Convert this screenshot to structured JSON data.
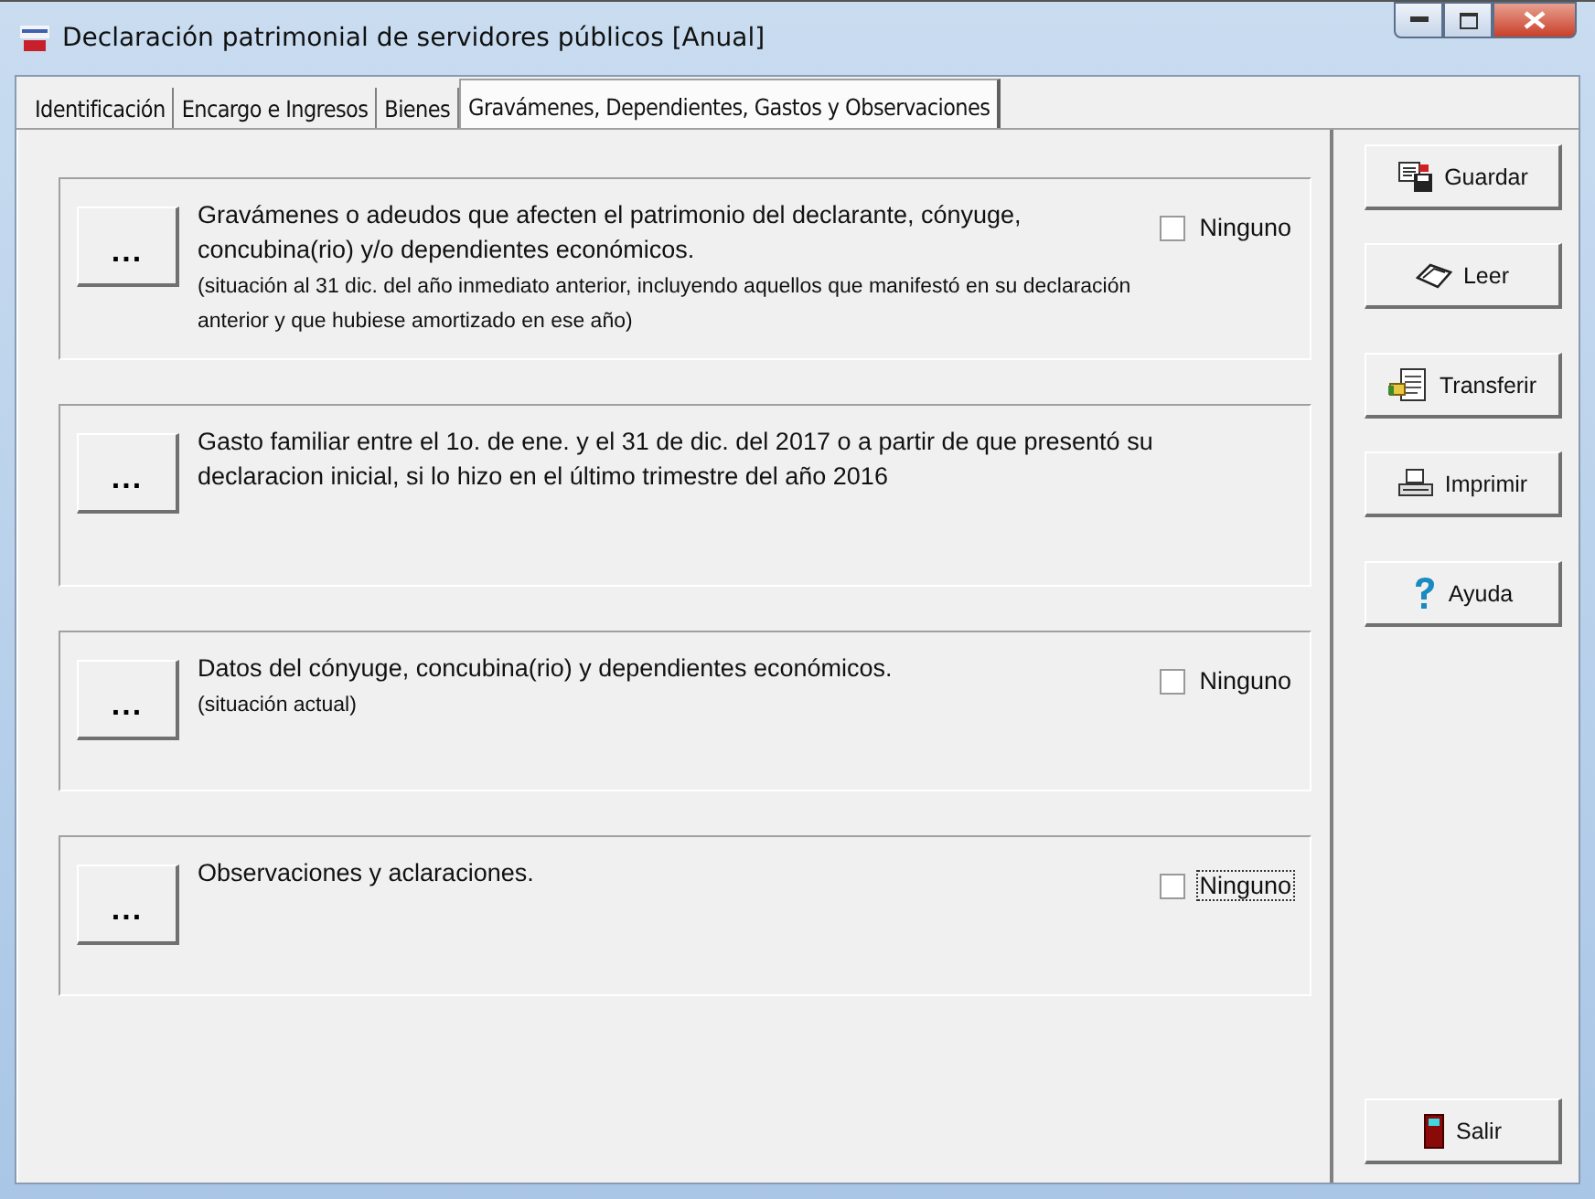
{
  "window": {
    "title": "Declaración patrimonial de servidores públicos [Anual]"
  },
  "tabs": [
    {
      "label": "Identificación",
      "selected": false
    },
    {
      "label": "Encargo e Ingresos",
      "selected": false
    },
    {
      "label": "Bienes",
      "selected": false
    },
    {
      "label": "Gravámenes, Dependientes, Gastos y Observaciones",
      "selected": true
    }
  ],
  "sections": [
    {
      "button": "...",
      "title": "Gravámenes o adeudos que afecten el patrimonio del declarante, cónyuge, concubina(rio) y/o dependientes económicos.",
      "note": "(situación al 31 dic. del año inmediato anterior, incluyendo aquellos que manifestó en su declaración anterior y que hubiese amortizado en ese año)",
      "checkbox": {
        "label": "Ninguno",
        "checked": false,
        "focused": false
      }
    },
    {
      "button": "...",
      "title": "Gasto familiar entre el 1o. de ene. y el 31 de dic. del 2017 o a partir de que presentó su declaracion inicial, si lo hizo en el último trimestre del año 2016"
    },
    {
      "button": "...",
      "title": "Datos del cónyuge, concubina(rio) y dependientes económicos.",
      "note": "(situación actual)",
      "checkbox": {
        "label": "Ninguno",
        "checked": false,
        "focused": false
      }
    },
    {
      "button": "...",
      "title": "Observaciones y aclaraciones.",
      "checkbox": {
        "label": "Ninguno",
        "checked": false,
        "focused": true
      }
    }
  ],
  "actions": [
    {
      "label": "Guardar"
    },
    {
      "label": "Leer"
    },
    {
      "label": "Transferir"
    },
    {
      "label": "Imprimir"
    },
    {
      "label": "Ayuda"
    },
    {
      "label": "Salir"
    }
  ]
}
